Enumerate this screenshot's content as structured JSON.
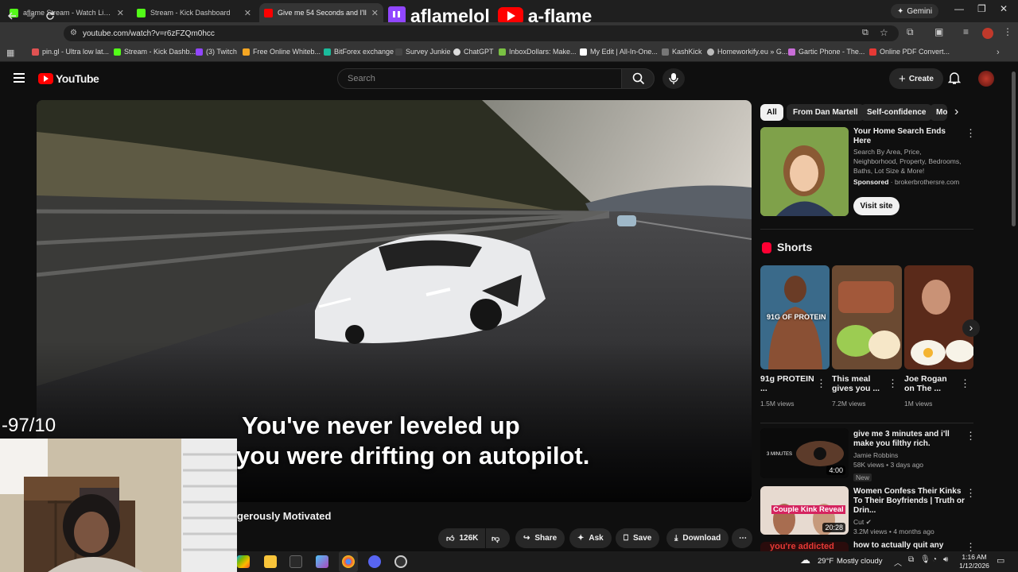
{
  "browser": {
    "tabs": [
      {
        "title": "aflame Stream - Watch Live on"
      },
      {
        "title": "Stream - Kick Dashboard"
      },
      {
        "title": "Give me 54 Seconds and I'll"
      }
    ],
    "gemini_label": "Gemini",
    "url": "youtube.com/watch?v=r6zFZQm0hcc",
    "bookmarks": [
      {
        "label": "pin.gl - Ultra low lat..."
      },
      {
        "label": "Stream - Kick Dashb..."
      },
      {
        "label": "(3) Twitch"
      },
      {
        "label": "Free Online Whiteb..."
      },
      {
        "label": "BitForex exchange"
      },
      {
        "label": "Survey Junkie"
      },
      {
        "label": "ChatGPT"
      },
      {
        "label": "InboxDollars: Make..."
      },
      {
        "label": "My Edit | All-In-One..."
      },
      {
        "label": "KashKick"
      },
      {
        "label": "Homeworkify.eu » G..."
      },
      {
        "label": "Gartic Phone - The..."
      },
      {
        "label": "Online PDF Convert..."
      }
    ]
  },
  "stream_overlay": {
    "twitch_name": "aflamelol",
    "youtube_name": "a-flame",
    "rating": "-97/10"
  },
  "youtube": {
    "logo_text": "YouTube",
    "search_placeholder": "Search",
    "create_label": "Create",
    "video": {
      "caption_line1": "You've never leveled up",
      "caption_line2": "you were drifting on autopilot.",
      "title_fragment": "gerously Motivated",
      "likes": "126K",
      "share": "Share",
      "ask": "Ask",
      "save": "Save",
      "download": "Download"
    },
    "chips": [
      "All",
      "From Dan Martell",
      "Self-confidence",
      "Mo"
    ],
    "ad": {
      "title": "Your Home Search Ends Here",
      "description": "Search By Area, Price, Neighborhood, Property, Bedrooms, Baths, Lot Size & More!",
      "sponsored": "Sponsored",
      "domain": "brokerbrothersre.com",
      "cta": "Visit site"
    },
    "shorts": {
      "heading": "Shorts",
      "items": [
        {
          "title": "91g PROTEIN ...",
          "views": "1.5M views",
          "overlay": "91G OF PROTEIN"
        },
        {
          "title": "This meal gives you ...",
          "views": "7.2M views"
        },
        {
          "title": "Joe Rogan on The ...",
          "views": "1M views"
        }
      ]
    },
    "recommendations": [
      {
        "title": "give me 3 minutes and i'll make you filthy rich.",
        "channel": "Jamie Robbins",
        "meta": "58K views • 3 days ago",
        "badge": "New",
        "duration": "4:00",
        "thumb_text": "3 MINUTES"
      },
      {
        "title": "Women Confess Their Kinks To Their Boyfriends | Truth or Drin...",
        "channel": "Cut",
        "meta": "3.2M views • 4 months ago",
        "duration": "20:28",
        "thumb_text": "Couple Kink Reveal"
      },
      {
        "title": "how to actually quit any",
        "thumb_text": "you're addicted"
      }
    ]
  },
  "taskbar": {
    "weather_temp": "29°F",
    "weather_desc": "Mostly cloudy",
    "time": "1:16 AM",
    "date": "1/12/2026"
  }
}
